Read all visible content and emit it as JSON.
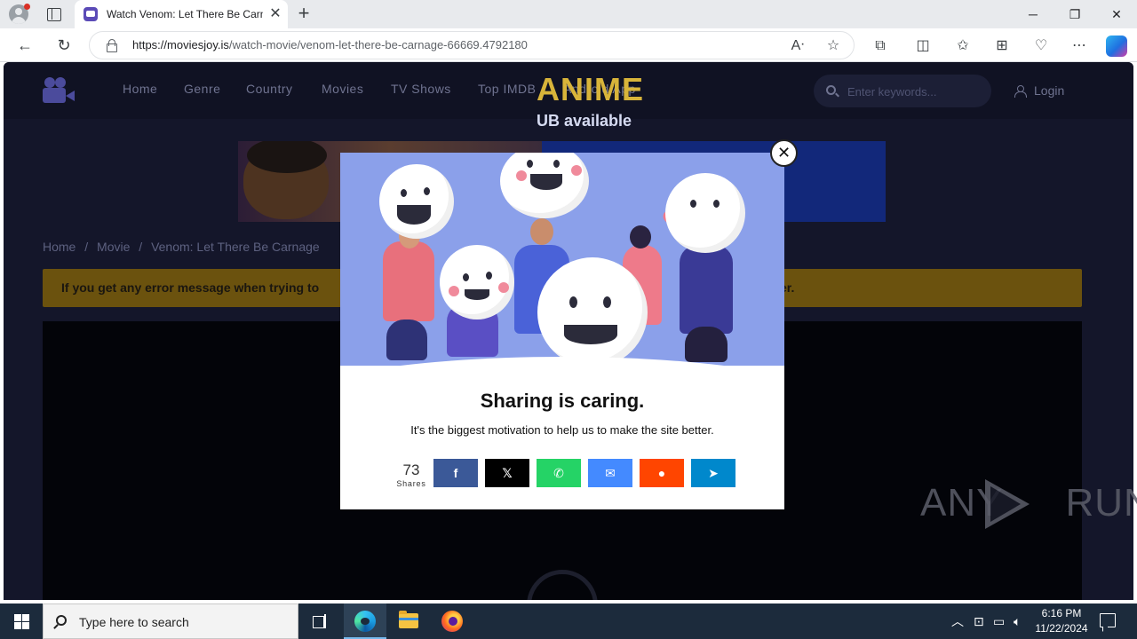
{
  "browser": {
    "tab_title": "Watch Venom: Let There Be Carn",
    "tab_close": "✕",
    "new_tab": "+",
    "url_host": "https://moviesjoy.is",
    "url_path": "/watch-movie/venom-let-there-be-carnage-66669.4792180",
    "window_controls": {
      "minimize": "─",
      "maximize": "❐",
      "close": "✕"
    },
    "icons": [
      "back-icon",
      "refresh-icon",
      "lock-icon",
      "read-aloud-icon",
      "favorite-icon",
      "extensions-icon",
      "split-screen-icon",
      "favorites-icon",
      "collections-icon",
      "browser-essentials-icon",
      "more-icon",
      "copilot-icon"
    ]
  },
  "site": {
    "menu": [
      "Home",
      "Genre",
      "Country",
      "Movies",
      "TV Shows",
      "Top IMDB",
      "Android App"
    ],
    "search_placeholder": "Enter keywords...",
    "login": "Login",
    "banner_title": "ANIME",
    "banner_sub": "UB available",
    "breadcrumb": [
      "Home",
      "/",
      "Movie",
      "/",
      "Venom: Let There Be Carnage"
    ],
    "alert_text": "If you get any error message when trying to",
    "alert_tail": "er."
  },
  "modal": {
    "title": "Sharing is caring.",
    "subtitle": "It's the biggest motivation to help us to make the site better.",
    "share_count": "73",
    "share_label": "Shares",
    "close_label": "✕",
    "buttons": [
      {
        "label": "f",
        "color": "#3b5998",
        "name": "facebook"
      },
      {
        "label": "𝕏",
        "color": "#000000",
        "name": "x-twitter"
      },
      {
        "label": "✆",
        "color": "#25d366",
        "name": "whatsapp"
      },
      {
        "label": "✉",
        "color": "#448aff",
        "name": "messenger"
      },
      {
        "label": "●",
        "color": "#ff4500",
        "name": "reddit"
      },
      {
        "label": "➤",
        "color": "#0088cc",
        "name": "telegram"
      }
    ]
  },
  "watermark": {
    "left": "ANY",
    "right": "RUN"
  },
  "taskbar": {
    "search_placeholder": "Type here to search",
    "time": "6:16 PM",
    "date": "11/22/2024",
    "tray_icons": [
      "chevron-up-icon",
      "network-adapter-icon",
      "network-icon",
      "volume-icon"
    ]
  }
}
